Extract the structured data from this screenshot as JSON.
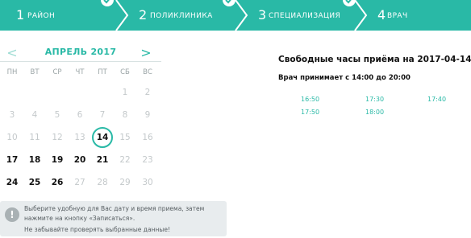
{
  "steps": [
    {
      "number": "1",
      "label": "РАЙОН",
      "completed": true
    },
    {
      "number": "2",
      "label": "ПОЛИКЛИНИКА",
      "completed": true
    },
    {
      "number": "3",
      "label": "СПЕЦИАЛИЗАЦИЯ",
      "completed": true
    },
    {
      "number": "4",
      "label": "ВРАЧ",
      "completed": false
    }
  ],
  "colors": {
    "accent": "#29b9a6",
    "step_arrow": "#1f9c8c",
    "muted_day": "#c4c9cb",
    "info_bg": "#e8ecee"
  },
  "calendar": {
    "prev_label": "<",
    "next_label": ">",
    "month_title": "АПРЕЛЬ 2017",
    "weekdays": [
      "ПН",
      "ВТ",
      "СР",
      "ЧТ",
      "ПТ",
      "СБ",
      "ВС"
    ],
    "selected_day": "14",
    "weeks": [
      [
        {
          "d": "",
          "s": "off"
        },
        {
          "d": "",
          "s": "off"
        },
        {
          "d": "",
          "s": "off"
        },
        {
          "d": "",
          "s": "off"
        },
        {
          "d": "",
          "s": "off"
        },
        {
          "d": "1",
          "s": "off"
        },
        {
          "d": "2",
          "s": "off"
        }
      ],
      [
        {
          "d": "3",
          "s": "off"
        },
        {
          "d": "4",
          "s": "off"
        },
        {
          "d": "5",
          "s": "off"
        },
        {
          "d": "6",
          "s": "off"
        },
        {
          "d": "7",
          "s": "off"
        },
        {
          "d": "8",
          "s": "off"
        },
        {
          "d": "9",
          "s": "off"
        }
      ],
      [
        {
          "d": "10",
          "s": "off"
        },
        {
          "d": "11",
          "s": "off"
        },
        {
          "d": "12",
          "s": "off"
        },
        {
          "d": "13",
          "s": "off"
        },
        {
          "d": "14",
          "s": "sel"
        },
        {
          "d": "15",
          "s": "off"
        },
        {
          "d": "16",
          "s": "off"
        }
      ],
      [
        {
          "d": "17",
          "s": "on"
        },
        {
          "d": "18",
          "s": "on"
        },
        {
          "d": "19",
          "s": "on"
        },
        {
          "d": "20",
          "s": "on"
        },
        {
          "d": "21",
          "s": "on"
        },
        {
          "d": "22",
          "s": "off"
        },
        {
          "d": "23",
          "s": "off"
        }
      ],
      [
        {
          "d": "24",
          "s": "on"
        },
        {
          "d": "25",
          "s": "on"
        },
        {
          "d": "26",
          "s": "on"
        },
        {
          "d": "27",
          "s": "off"
        },
        {
          "d": "28",
          "s": "off"
        },
        {
          "d": "29",
          "s": "off"
        },
        {
          "d": "30",
          "s": "off"
        }
      ]
    ]
  },
  "info": {
    "icon": "exclamation-icon",
    "line1": "Выберите удобную для Вас дату и время приема, затем",
    "line2": "нажмите на кнопку «Записаться».",
    "line3": "Не забывайте проверять выбранные данные!"
  },
  "slots": {
    "title": "Свободные часы приёма на 2017-04-14",
    "hours": "Врач принимает с 14:00 до 20:00",
    "times": [
      "16:50",
      "17:30",
      "17:40",
      "17:50",
      "18:00"
    ]
  }
}
